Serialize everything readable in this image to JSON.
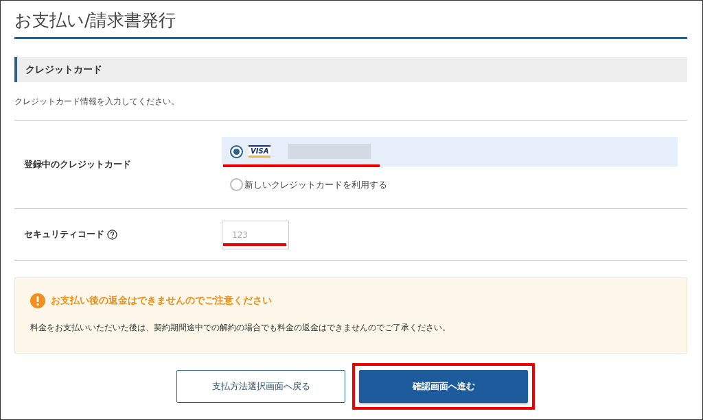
{
  "title": "お支払い/請求書発行",
  "section_heading": "クレジットカード",
  "instructions": "クレジットカード情報を入力してください。",
  "card_row": {
    "label": "登録中のクレジットカード",
    "options": [
      {
        "kind": "card",
        "brand": "VISA",
        "selected": true,
        "highlighted": true
      },
      {
        "kind": "new",
        "label": "新しいクレジットカードを利用する",
        "selected": false
      }
    ]
  },
  "security_code": {
    "label": "セキュリティコード",
    "placeholder": "123",
    "highlighted": true
  },
  "notice": {
    "title": "お支払い後の返金はできませんのでご注意ください",
    "body": "料金をお支払いいただいた後は、契約期間途中での解約の場合でも料金の返金はできませんのでご了承ください。"
  },
  "buttons": [
    {
      "kind": "secondary",
      "label": "支払方法選択画面へ戻る",
      "highlighted": false
    },
    {
      "kind": "primary",
      "label": "確認画面へ進む",
      "highlighted": true
    }
  ]
}
